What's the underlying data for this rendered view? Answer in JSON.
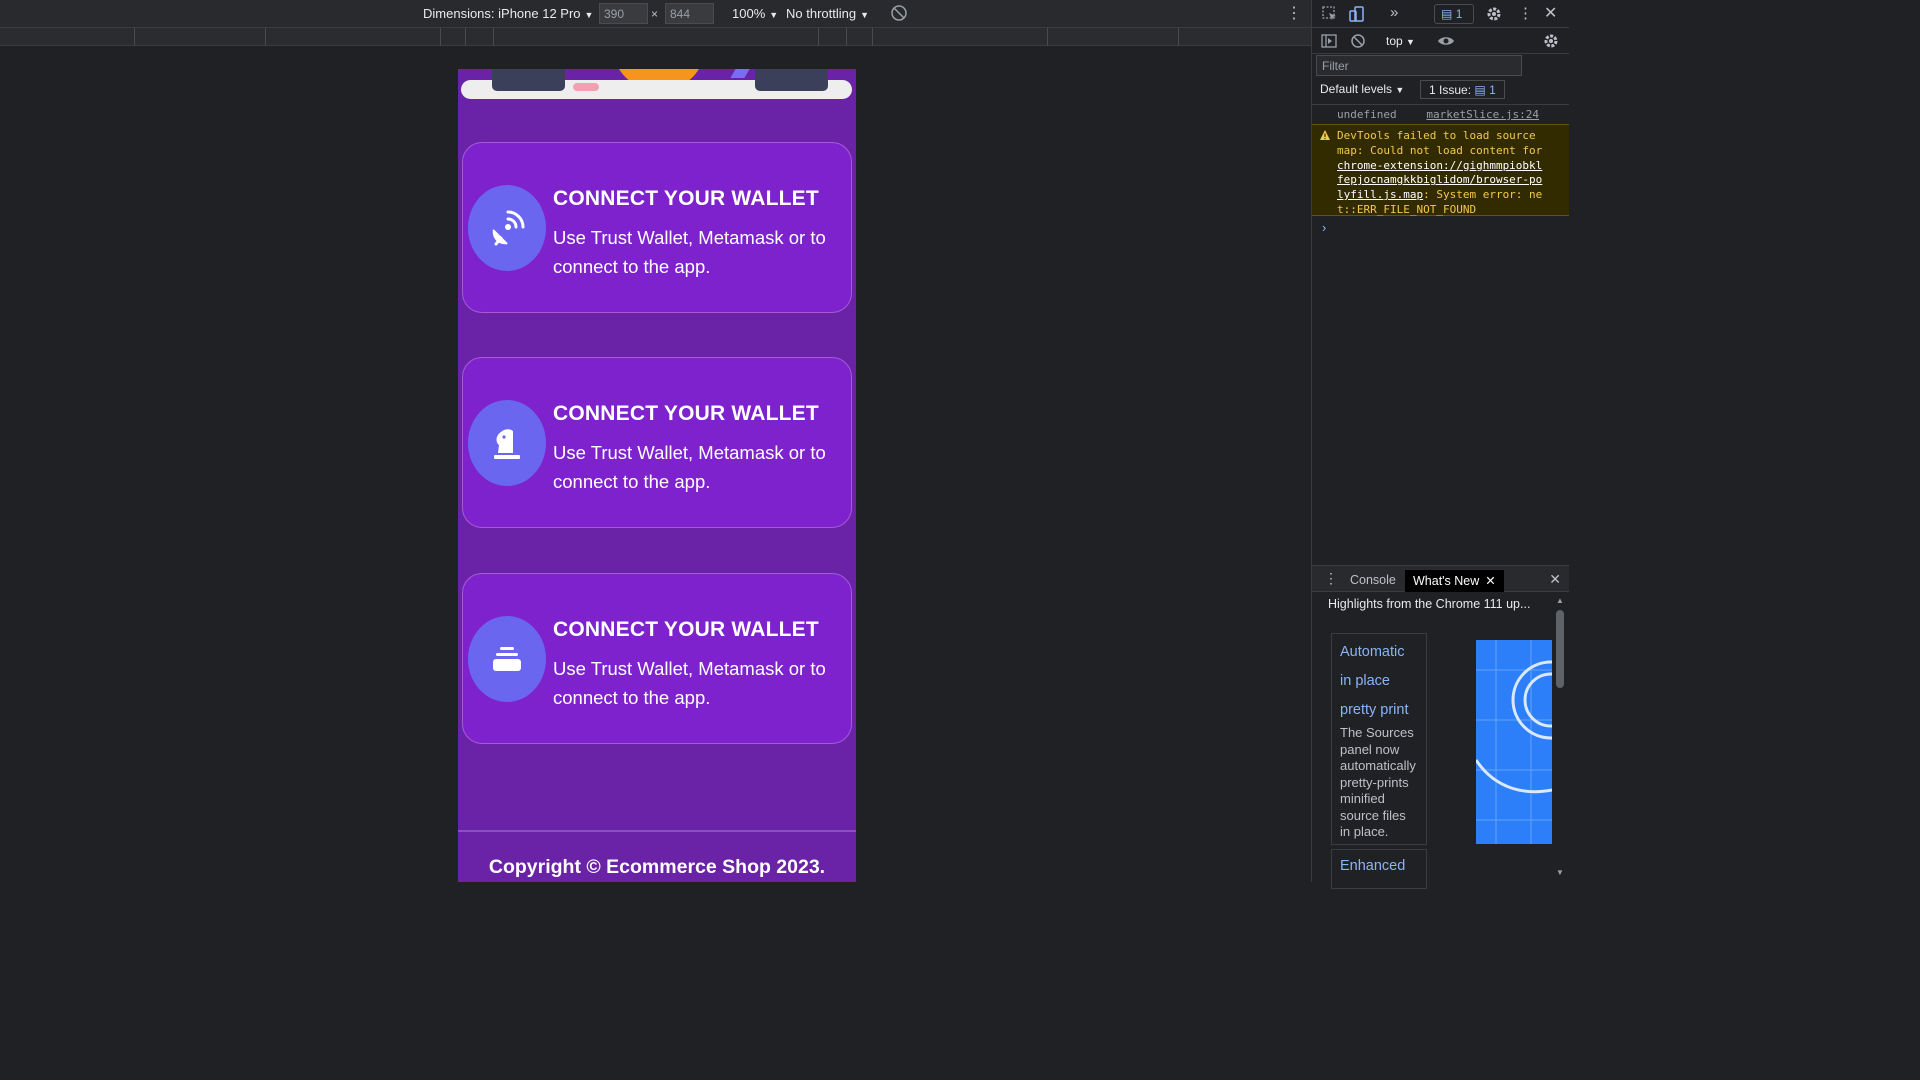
{
  "device_toolbar": {
    "dimensions_label": "Dimensions: iPhone 12 Pro",
    "width_value": "390",
    "height_value": "844",
    "times_sign": "×",
    "zoom_label": "100%",
    "throttle_label": "No throttling"
  },
  "page": {
    "cards": [
      {
        "icon": "satellite-dish-icon",
        "title": "CONNECT YOUR WALLET",
        "description": "Use Trust Wallet, Metamask or to connect to the app."
      },
      {
        "icon": "chess-knight-icon",
        "title": "CONNECT YOUR WALLET",
        "description": "Use Trust Wallet, Metamask or to connect to the app."
      },
      {
        "icon": "layer-stack-icon",
        "title": "CONNECT YOUR WALLET",
        "description": "Use Trust Wallet, Metamask or to connect to the app."
      }
    ],
    "copyright": "Copyright © Ecommerce Shop 2023.",
    "colors": {
      "background": "#6a22a6",
      "card": "#7e22ce",
      "icon_circle": "#6b66f0",
      "hero_sun": "#f7941d"
    }
  },
  "devtools": {
    "issues_badge": "1",
    "context": "top",
    "filter_placeholder": "Filter",
    "default_levels": "Default levels",
    "issue_count_label": "1 Issue:",
    "issue_count_value": "1",
    "log": {
      "value": "undefined",
      "source": "marketSlice.js:24"
    },
    "warning": {
      "prefix": "DevTools failed to load source map: Could not load content for ",
      "link": "chrome-extension://gighmmpiobklfepjocnamgkkbiglidom/browser-polyfill.js.map",
      "suffix": ": System error: net::ERR_FILE_NOT_FOUND"
    },
    "drawer_tabs": {
      "console": "Console",
      "whats_new": "What's New"
    },
    "whats_new": {
      "heading": "Highlights from the Chrome 111 up...",
      "card_title_lines": [
        "Automatic",
        "in place",
        "pretty print"
      ],
      "card_description": "The Sources panel now automatically pretty-prints minified source files in place.",
      "next_card_title": "Enhanced"
    }
  }
}
